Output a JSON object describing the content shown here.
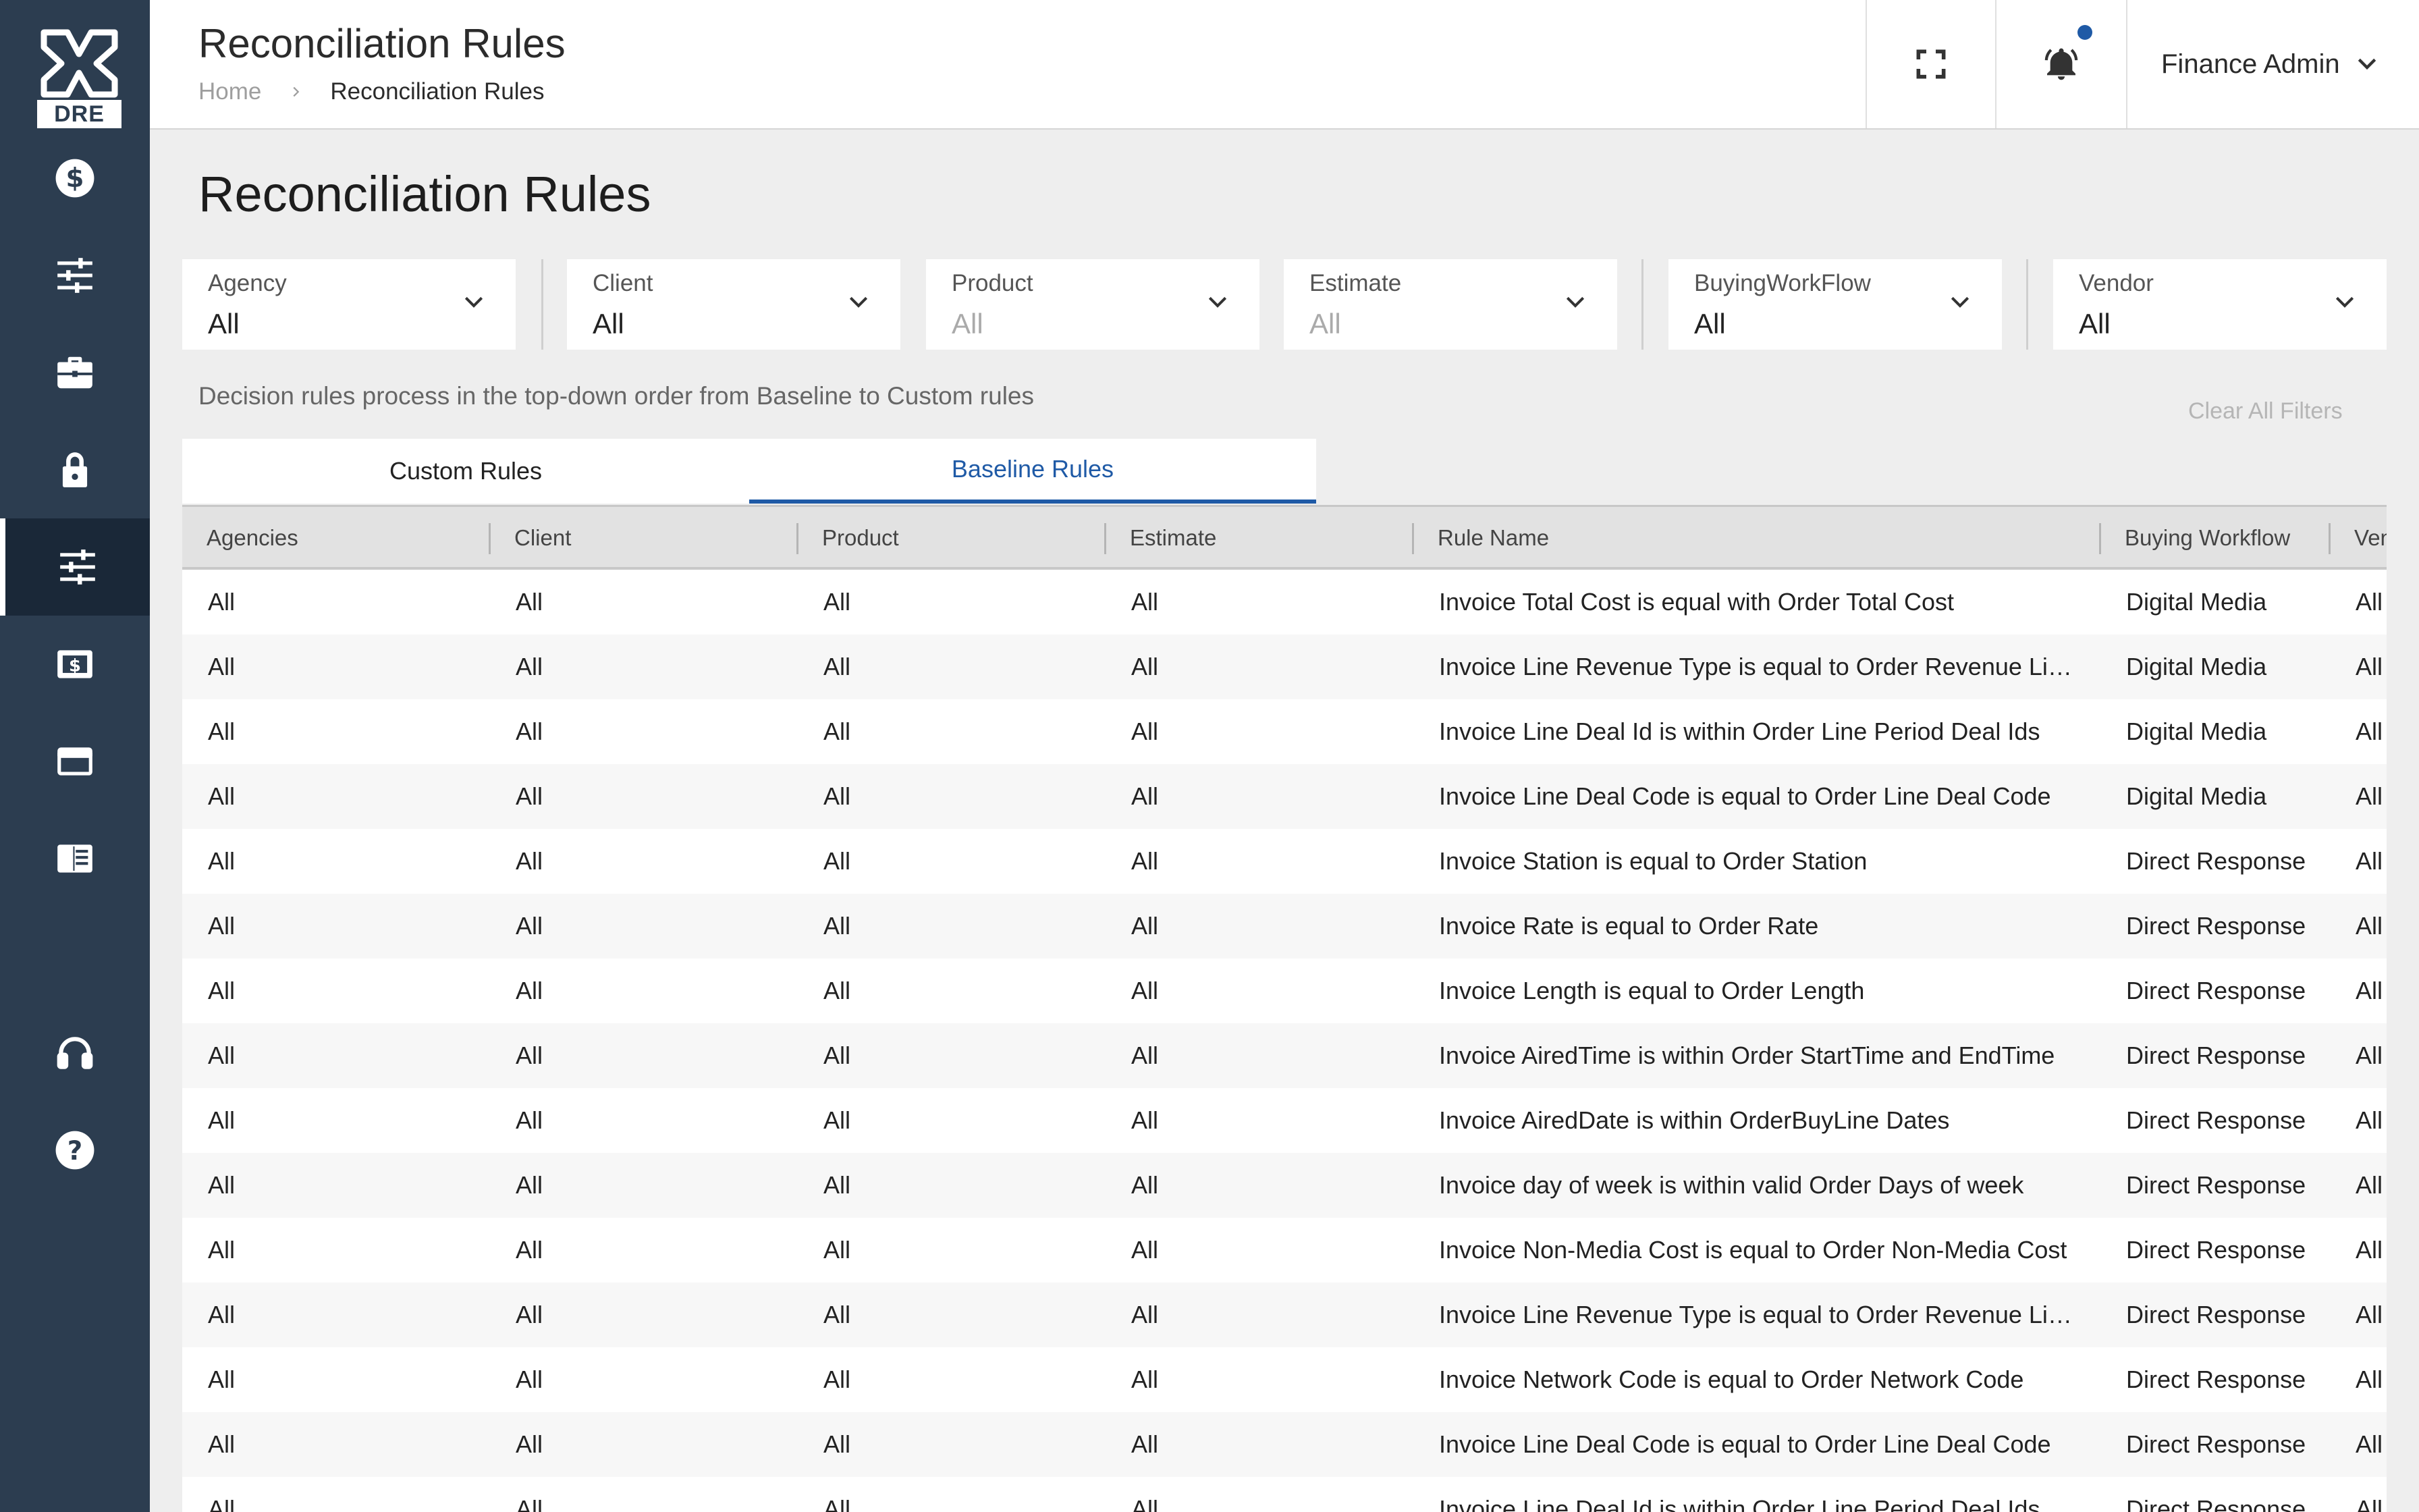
{
  "logo": {
    "text": "DRE"
  },
  "sidebar": {
    "items": [
      {
        "icon": "dollar-circle-icon"
      },
      {
        "icon": "sliders-icon"
      },
      {
        "icon": "briefcase-icon"
      },
      {
        "icon": "lock-icon"
      },
      {
        "icon": "rules-sliders-icon",
        "active": true
      },
      {
        "icon": "invoice-dollar-icon"
      },
      {
        "icon": "credit-card-icon"
      },
      {
        "icon": "ledger-icon"
      },
      {
        "icon": "headset-icon"
      },
      {
        "icon": "help-icon"
      }
    ]
  },
  "header": {
    "title": "Reconciliation Rules",
    "breadcrumb": {
      "home": "Home",
      "current": "Reconciliation Rules"
    },
    "user": "Finance Admin"
  },
  "page": {
    "title": "Reconciliation Rules",
    "helper_text": "Decision rules process in the top-down order from Baseline to Custom rules",
    "clear_filters": "Clear All Filters"
  },
  "filters": [
    {
      "label": "Agency",
      "value": "All",
      "disabled": false
    },
    {
      "label": "Client",
      "value": "All",
      "disabled": false
    },
    {
      "label": "Product",
      "value": "All",
      "disabled": true
    },
    {
      "label": "Estimate",
      "value": "All",
      "disabled": true
    },
    {
      "label": "BuyingWorkFlow",
      "value": "All",
      "disabled": false
    },
    {
      "label": "Vendor",
      "value": "All",
      "disabled": false
    }
  ],
  "tabs": [
    {
      "label": "Custom Rules",
      "active": false
    },
    {
      "label": "Baseline Rules",
      "active": true
    }
  ],
  "table": {
    "columns": [
      "Agencies",
      "Client",
      "Product",
      "Estimate",
      "Rule Name",
      "Buying Workflow",
      "Vendor"
    ],
    "rows": [
      [
        "All",
        "All",
        "All",
        "All",
        "Invoice Total Cost is equal with Order Total Cost",
        "Digital Media",
        "All"
      ],
      [
        "All",
        "All",
        "All",
        "All",
        "Invoice Line Revenue Type is equal to Order Revenue Line Type",
        "Digital Media",
        "All"
      ],
      [
        "All",
        "All",
        "All",
        "All",
        "Invoice Line Deal Id is within Order Line Period Deal Ids",
        "Digital Media",
        "All"
      ],
      [
        "All",
        "All",
        "All",
        "All",
        "Invoice Line Deal Code is equal to Order Line Deal Code",
        "Digital Media",
        "All"
      ],
      [
        "All",
        "All",
        "All",
        "All",
        "Invoice Station is equal to Order Station",
        "Direct Response",
        "All"
      ],
      [
        "All",
        "All",
        "All",
        "All",
        "Invoice Rate is equal to Order Rate",
        "Direct Response",
        "All"
      ],
      [
        "All",
        "All",
        "All",
        "All",
        "Invoice Length is equal to Order Length",
        "Direct Response",
        "All"
      ],
      [
        "All",
        "All",
        "All",
        "All",
        "Invoice AiredTime is within Order StartTime and EndTime",
        "Direct Response",
        "All"
      ],
      [
        "All",
        "All",
        "All",
        "All",
        "Invoice AiredDate is within OrderBuyLine Dates",
        "Direct Response",
        "All"
      ],
      [
        "All",
        "All",
        "All",
        "All",
        "Invoice day of week is within valid Order Days of week",
        "Direct Response",
        "All"
      ],
      [
        "All",
        "All",
        "All",
        "All",
        "Invoice Non-Media Cost is equal to Order Non-Media Cost",
        "Direct Response",
        "All"
      ],
      [
        "All",
        "All",
        "All",
        "All",
        "Invoice Line Revenue Type is equal to Order Revenue Line Type",
        "Direct Response",
        "All"
      ],
      [
        "All",
        "All",
        "All",
        "All",
        "Invoice Network Code is equal to Order Network Code",
        "Direct Response",
        "All"
      ],
      [
        "All",
        "All",
        "All",
        "All",
        "Invoice Line Deal Code is equal to Order Line Deal Code",
        "Direct Response",
        "All"
      ],
      [
        "All",
        "All",
        "All",
        "All",
        "Invoice Line Deal Id is within Order Line Period Deal Ids",
        "Direct Response",
        "All"
      ]
    ]
  },
  "colors": {
    "sidebar": "#2c3d50",
    "accent": "#1f5aa6"
  }
}
